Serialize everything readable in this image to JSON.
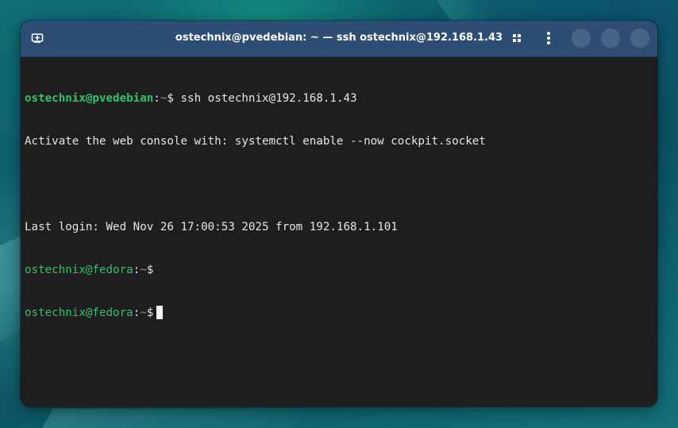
{
  "window": {
    "title": "ostechnix@pvedebian: ~ — ssh ostechnix@192.168.1.43"
  },
  "headerbar": {
    "icons": {
      "new_tab": "new-tab-icon",
      "tabs_overview": "tabs-grid-icon",
      "menu": "kebab-menu-icon"
    }
  },
  "terminal": {
    "lines": [
      {
        "user": "ostechnix@pvedebian",
        "sep": ":",
        "path": "~",
        "prompt": "$ ",
        "command": "ssh ostechnix@192.168.1.43"
      },
      {
        "text": "Activate the web console with: systemctl enable --now cockpit.socket"
      },
      {
        "text": ""
      },
      {
        "text": "Last login: Wed Nov 26 17:00:53 2025 from 192.168.1.101"
      },
      {
        "user": "ostechnix@fedora",
        "sep": ":",
        "path": "~",
        "prompt": "$",
        "command": ""
      },
      {
        "user": "ostechnix@fedora",
        "sep": ":",
        "path": "~",
        "prompt": "$",
        "command": ""
      }
    ]
  },
  "colors": {
    "headerbar": "#2e4d75",
    "terminal_bg": "#1e1e20",
    "prompt_user": "#33c26a",
    "prompt_path_local": "#5aa0e6",
    "prompt_path_remote": "#3fb5a8",
    "text": "#e6e6e6"
  }
}
